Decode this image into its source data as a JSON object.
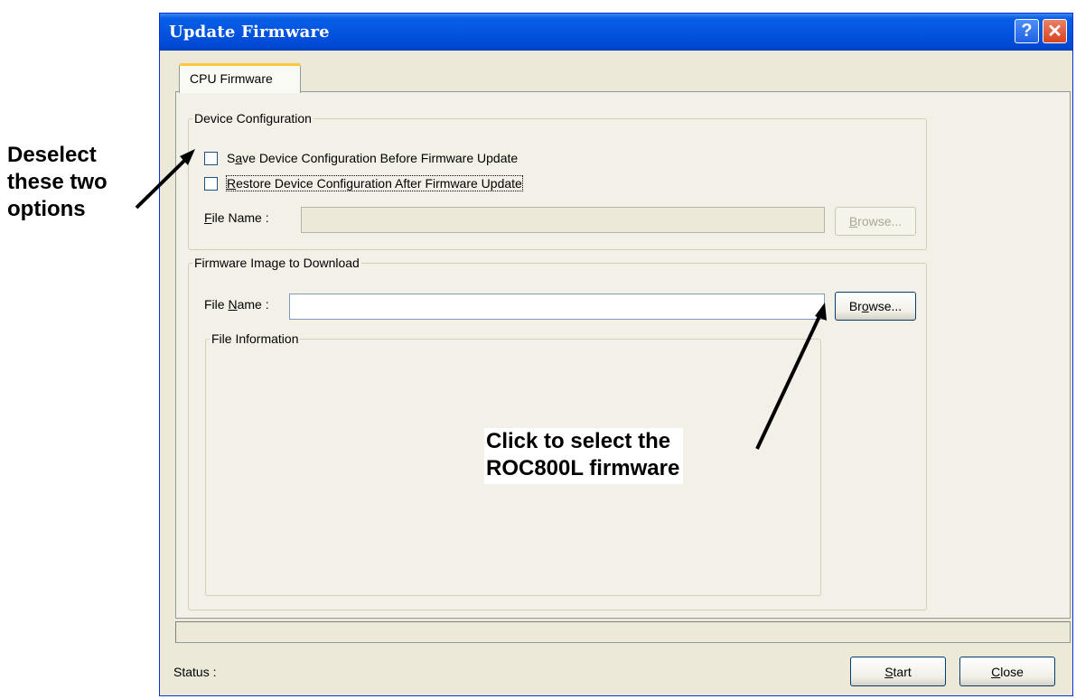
{
  "annotations": {
    "left_lines": [
      "Deselect",
      "these two",
      "options"
    ],
    "right_lines": [
      "Click to select the",
      "ROC800L firmware"
    ]
  },
  "window": {
    "title": "Update Firmware",
    "help_icon": "help-icon",
    "close_icon": "close-icon"
  },
  "tab": {
    "label": "CPU Firmware"
  },
  "device_config": {
    "legend": "Device Configuration",
    "save_option": {
      "label": "Save Device Configuration Before Firmware Update",
      "checked": false
    },
    "restore_option": {
      "label": "Restore Device Configuration After Firmware Update",
      "checked": false
    },
    "file_name_label": "File Name :",
    "file_name_value": "",
    "browse_label": "Browse..."
  },
  "firmware_image": {
    "legend": "Firmware Image to Download",
    "file_name_label": "File Name :",
    "file_name_value": "",
    "browse_label": "Browse...",
    "file_info_legend": "File Information"
  },
  "footer": {
    "progress_percent": 0,
    "status_label": "Status :",
    "start_label": "Start",
    "close_label": "Close"
  },
  "colors": {
    "titlebar": "#0454e0",
    "dialog_bg": "#ece9d8",
    "panel_bg": "#f3f1e7",
    "tab_highlight": "#ffc83c"
  }
}
